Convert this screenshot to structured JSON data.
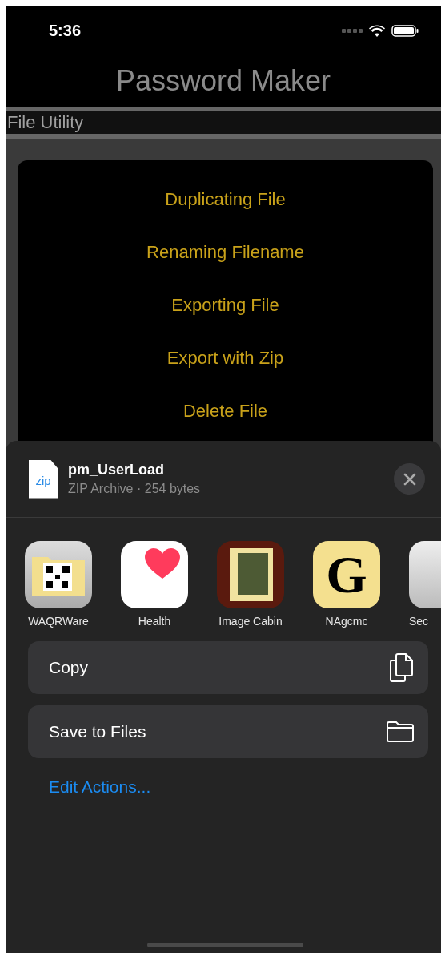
{
  "status_bar": {
    "time": "5:36"
  },
  "title": "Password Maker",
  "section": {
    "label": "File Utility"
  },
  "menu": [
    "Duplicating File",
    "Renaming Filename",
    "Exporting File",
    "Export with Zip",
    "Delete File"
  ],
  "share_sheet": {
    "file": {
      "icon_label": "zip",
      "name": "pm_UserLoad",
      "info": "ZIP Archive · 254 bytes"
    },
    "apps": [
      {
        "name": "WAQRWare",
        "kind": "qrfolder"
      },
      {
        "name": "Health",
        "kind": "heart"
      },
      {
        "name": "Image Cabin",
        "kind": "painting"
      },
      {
        "name": "NAgcmc",
        "kind": "letter",
        "letter": "G"
      },
      {
        "name": "Sec",
        "kind": "doc"
      }
    ],
    "actions": [
      {
        "label": "Copy",
        "kind": "copy"
      },
      {
        "label": "Save to Files",
        "kind": "folder"
      }
    ],
    "edit_link": "Edit Actions..."
  }
}
